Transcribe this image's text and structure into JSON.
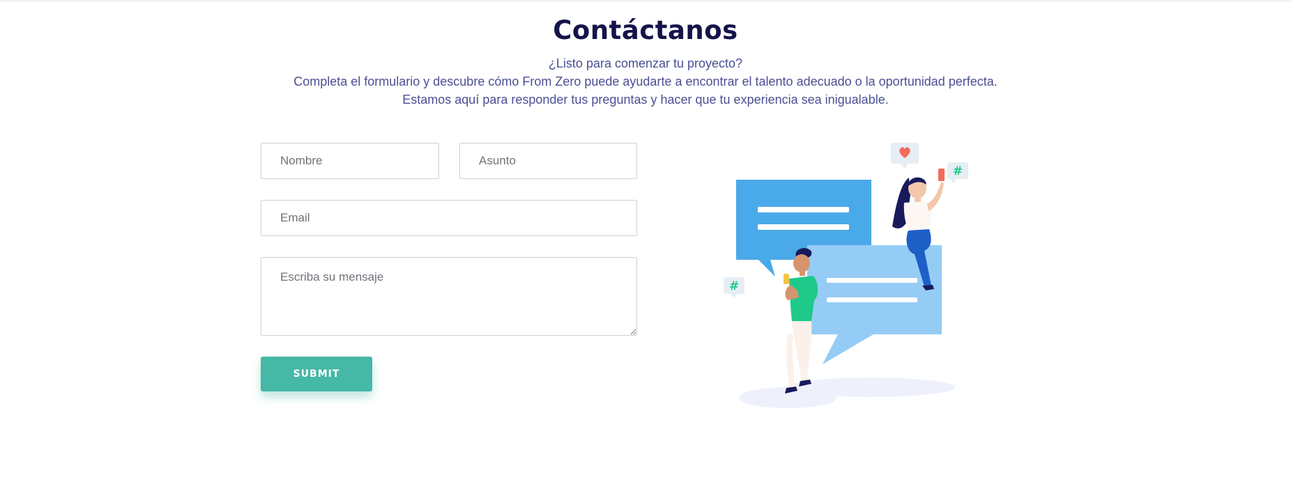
{
  "header": {
    "title": "Contáctanos",
    "intro_lines": [
      "¿Listo para comenzar tu proyecto?",
      "Completa el formulario y descubre cómo From Zero puede ayudarte a encontrar el talento adecuado o la oportunidad perfecta.",
      "Estamos aquí para responder tus preguntas y hacer que tu experiencia sea inigualable."
    ]
  },
  "form": {
    "name_placeholder": "Nombre",
    "subject_placeholder": "Asunto",
    "email_placeholder": "Email",
    "message_placeholder": "Escriba su mensaje",
    "submit_label": "SUBMIT"
  },
  "illustration": {
    "icons": [
      "heart-icon",
      "hashtag-icon",
      "hashtag-icon"
    ],
    "colors": {
      "bubble_dark": "#4aa9e8",
      "bubble_light": "#95ccf5",
      "accent_green": "#1fc98a",
      "accent_red": "#f26b5b",
      "shadow": "#eef0fb"
    }
  },
  "theme": {
    "title_color": "#14144a",
    "text_color": "#4b4f93",
    "submit_color": "#45b8a6"
  }
}
